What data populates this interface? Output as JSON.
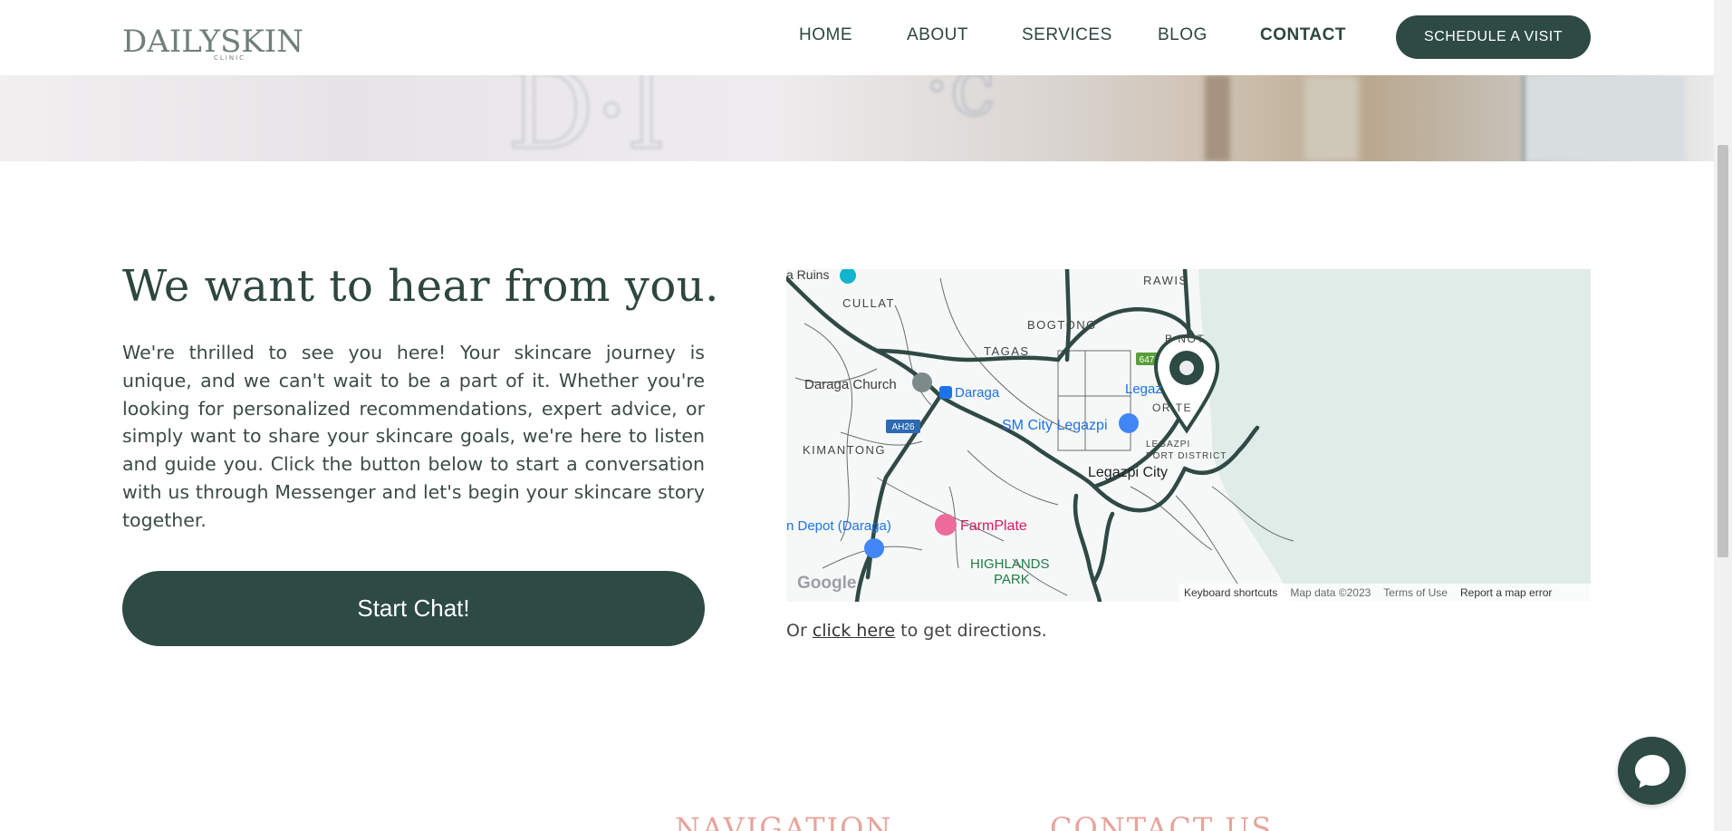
{
  "header": {
    "logo_text": "DAILYSKIN",
    "logo_sub": "CLINIC",
    "nav": [
      {
        "label": "HOME"
      },
      {
        "label": "ABOUT"
      },
      {
        "label": "SERVICES"
      },
      {
        "label": "BLOG"
      },
      {
        "label": "CONTACT"
      }
    ],
    "cta_label": "SCHEDULE A VISIT"
  },
  "contact": {
    "heading": "We want to hear from you.",
    "paragraph": "We're thrilled to see you here! Your skincare journey is unique, and we can't wait to be a part of it. Whether you're looking for personalized recommendations, expert advice, or simply want to share your skincare goals, we're here to listen and guide you. Click the button below to start a conversation with us through Messenger and let's begin your skincare story together.",
    "chat_button": "Start Chat!",
    "directions_prefix": "Or ",
    "directions_link": "click here",
    "directions_suffix": " to get directions."
  },
  "map": {
    "labels": {
      "ruins": "a Ruins",
      "cullat": "CULLAT",
      "rawis": "RAWIS",
      "bogtong": "BOGTONG",
      "tagas": "TAGAS",
      "daraga_church": "Daraga Church",
      "daraga": "Daraga",
      "ah26": "AH26",
      "kimantong": "KIMANTONG",
      "sm_city": "SM City Legazpi",
      "legazpi_short": "Legaz",
      "legazpi_city": "Legazpi City",
      "depot": "n Depot (Daraga)",
      "farmplate": "FarmPlate",
      "highlands": "HIGHLANDS",
      "park": "PARK",
      "port_district": "PORT DISTRICT",
      "legazpi_sm": "LEGAZPI",
      "orte": "OR    TE",
      "bonot": "B  NOT",
      "shield_647": "647"
    },
    "google": "Google",
    "attribution": {
      "keyboard": "Keyboard shortcuts",
      "mapdata": "Map data ©2023",
      "terms": "Terms of Use",
      "report": "Report a map error"
    }
  },
  "footer": {
    "navigation": "NAVIGATION",
    "contact_us": "CONTACT US"
  },
  "colors": {
    "brand": "#2d4a43",
    "accent": "#e8a49b",
    "water": "#dfece7"
  }
}
